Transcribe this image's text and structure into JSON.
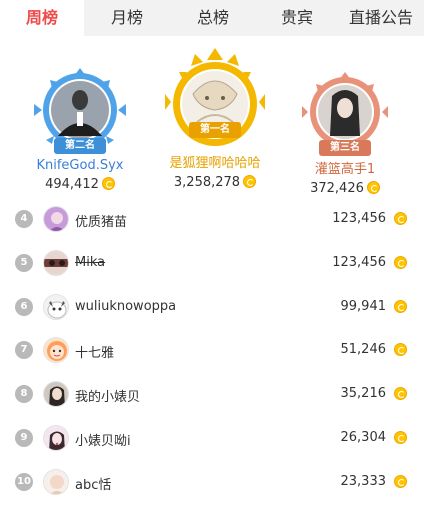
{
  "tabs": [
    {
      "label": "周榜",
      "active": true
    },
    {
      "label": "月榜",
      "active": false
    },
    {
      "label": "总榜",
      "active": false
    },
    {
      "label": "贵宾",
      "active": false
    },
    {
      "label": "直播公告",
      "active": false
    }
  ],
  "podium": {
    "first": {
      "ribbon": "第一名",
      "name": "是狐狸啊哈哈哈",
      "score": "3,258,278",
      "color": "#f5b800",
      "name_color": "#e8a100"
    },
    "second": {
      "ribbon": "第二名",
      "name": "KnifeGod.Syx",
      "score": "494,412",
      "color": "#4fa3e8",
      "name_color": "#3a7fd5"
    },
    "third": {
      "ribbon": "第三名",
      "name": "灌篮高手1",
      "score": "372,426",
      "color": "#e9927a",
      "name_color": "#d0673f"
    }
  },
  "ranking": [
    {
      "rank": "4",
      "name": "优质猪苗",
      "score": "123,456",
      "strike": false
    },
    {
      "rank": "5",
      "name": "Mika",
      "score": "123,456",
      "strike": true
    },
    {
      "rank": "6",
      "name": "wuliuknowoppa",
      "score": "99,941",
      "strike": false
    },
    {
      "rank": "7",
      "name": "十七雅",
      "score": "51,246",
      "strike": false
    },
    {
      "rank": "8",
      "name": "我的小婊贝",
      "score": "35,216",
      "strike": false
    },
    {
      "rank": "9",
      "name": "小婊贝呦i",
      "score": "26,304",
      "strike": false
    },
    {
      "rank": "10",
      "name": "abc恬",
      "score": "23,333",
      "strike": false
    }
  ],
  "icons": {
    "coin": "gold-coin-icon",
    "rank_badge": "rank-number-badge"
  }
}
